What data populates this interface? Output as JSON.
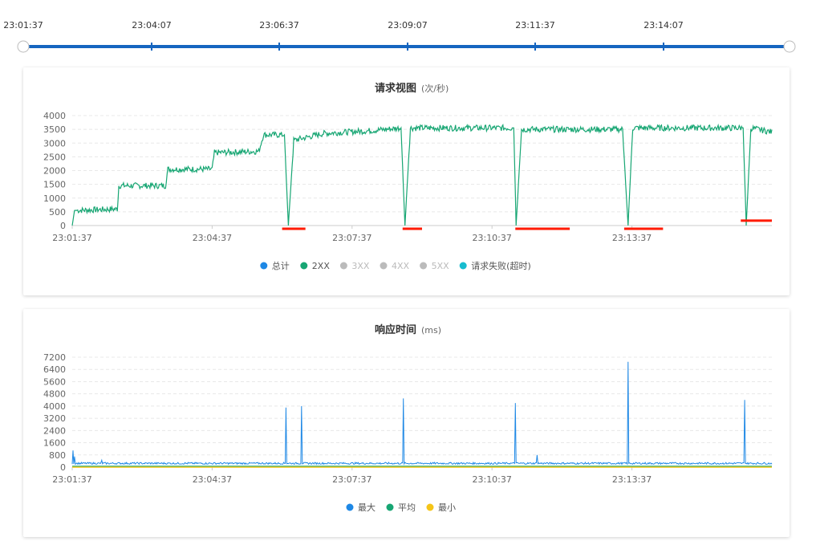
{
  "timeline": {
    "labels": [
      "23:01:37",
      "23:04:07",
      "23:06:37",
      "23:09:07",
      "23:11:37",
      "23:14:07"
    ],
    "color": "#1565c0"
  },
  "charts": [
    {
      "title": "请求视图",
      "unit": "(次/秒)",
      "legend": [
        {
          "name": "总计",
          "color": "#1e88e5",
          "active": true
        },
        {
          "name": "2XX",
          "color": "#17a673",
          "active": true
        },
        {
          "name": "3XX",
          "color": "#bbbbbb",
          "active": false
        },
        {
          "name": "4XX",
          "color": "#bbbbbb",
          "active": false
        },
        {
          "name": "5XX",
          "color": "#bbbbbb",
          "active": false
        },
        {
          "name": "请求失败(超时)",
          "color": "#17bccf",
          "active": true
        }
      ]
    },
    {
      "title": "响应时间",
      "unit": "(ms)",
      "legend": [
        {
          "name": "最大",
          "color": "#1e88e5",
          "active": true
        },
        {
          "name": "平均",
          "color": "#17a673",
          "active": true
        },
        {
          "name": "最小",
          "color": "#f5c518",
          "active": true
        }
      ]
    }
  ],
  "chart_data": [
    {
      "type": "line",
      "title": "请求视图",
      "ylabel": "(次/秒)",
      "x_ticks": [
        "23:01:37",
        "23:04:37",
        "23:07:37",
        "23:10:37",
        "23:13:37"
      ],
      "y_ticks": [
        0,
        500,
        1000,
        1500,
        2000,
        2500,
        3000,
        3500,
        4000
      ],
      "ylim": [
        0,
        4000
      ],
      "x_range": [
        "23:01:37",
        "23:16:37"
      ],
      "grid": true,
      "legend_position": "bottom",
      "series": [
        {
          "name": "2XX",
          "color": "#17a673",
          "points": [
            [
              "23:01:37",
              0
            ],
            [
              "23:01:40",
              550
            ],
            [
              "23:02:35",
              600
            ],
            [
              "23:02:37",
              1450
            ],
            [
              "23:03:37",
              1450
            ],
            [
              "23:03:40",
              2050
            ],
            [
              "23:04:37",
              2050
            ],
            [
              "23:04:40",
              2650
            ],
            [
              "23:05:37",
              2700
            ],
            [
              "23:05:43",
              3300
            ],
            [
              "23:06:10",
              3300
            ],
            [
              "23:06:15",
              0
            ],
            [
              "23:06:22",
              3100
            ],
            [
              "23:07:00",
              3350
            ],
            [
              "23:08:00",
              3450
            ],
            [
              "23:08:40",
              3550
            ],
            [
              "23:08:45",
              0
            ],
            [
              "23:08:52",
              3550
            ],
            [
              "23:10:30",
              3550
            ],
            [
              "23:11:05",
              3550
            ],
            [
              "23:11:08",
              0
            ],
            [
              "23:11:15",
              3500
            ],
            [
              "23:13:25",
              3500
            ],
            [
              "23:13:32",
              0
            ],
            [
              "23:13:38",
              3550
            ],
            [
              "23:16:00",
              3550
            ],
            [
              "23:16:04",
              0
            ],
            [
              "23:16:10",
              3550
            ],
            [
              "23:16:37",
              3400
            ]
          ]
        },
        {
          "name": "请求失败(超时)",
          "color": "#ff1a00",
          "segments": [
            {
              "start": "23:06:07",
              "end": "23:06:37",
              "value": 0
            },
            {
              "start": "23:08:42",
              "end": "23:09:07",
              "value": 0
            },
            {
              "start": "23:11:07",
              "end": "23:12:17",
              "value": 0
            },
            {
              "start": "23:13:27",
              "end": "23:14:17",
              "value": 0
            },
            {
              "start": "23:15:57",
              "end": "23:16:37",
              "value": 180
            }
          ]
        }
      ]
    },
    {
      "type": "line",
      "title": "响应时间",
      "ylabel": "(ms)",
      "x_ticks": [
        "23:01:37",
        "23:04:37",
        "23:07:37",
        "23:10:37",
        "23:13:37"
      ],
      "y_ticks": [
        0,
        800,
        1600,
        2400,
        3200,
        4000,
        4800,
        5600,
        6400,
        7200
      ],
      "ylim": [
        0,
        7200
      ],
      "x_range": [
        "23:01:37",
        "23:16:37"
      ],
      "grid": true,
      "legend_position": "bottom",
      "series": [
        {
          "name": "最大",
          "color": "#1e88e5",
          "baseline": 250,
          "spikes": [
            {
              "x": "23:01:38",
              "y": 1100
            },
            {
              "x": "23:01:40",
              "y": 700
            },
            {
              "x": "23:02:15",
              "y": 450
            },
            {
              "x": "23:06:12",
              "y": 3900
            },
            {
              "x": "23:06:32",
              "y": 4000
            },
            {
              "x": "23:08:43",
              "y": 4500
            },
            {
              "x": "23:11:07",
              "y": 4200
            },
            {
              "x": "23:11:35",
              "y": 800
            },
            {
              "x": "23:13:32",
              "y": 6900
            },
            {
              "x": "23:16:02",
              "y": 4400
            }
          ]
        },
        {
          "name": "平均",
          "color": "#17a673",
          "value": 50
        },
        {
          "name": "最小",
          "color": "#f5c518",
          "value": 0
        }
      ]
    }
  ]
}
